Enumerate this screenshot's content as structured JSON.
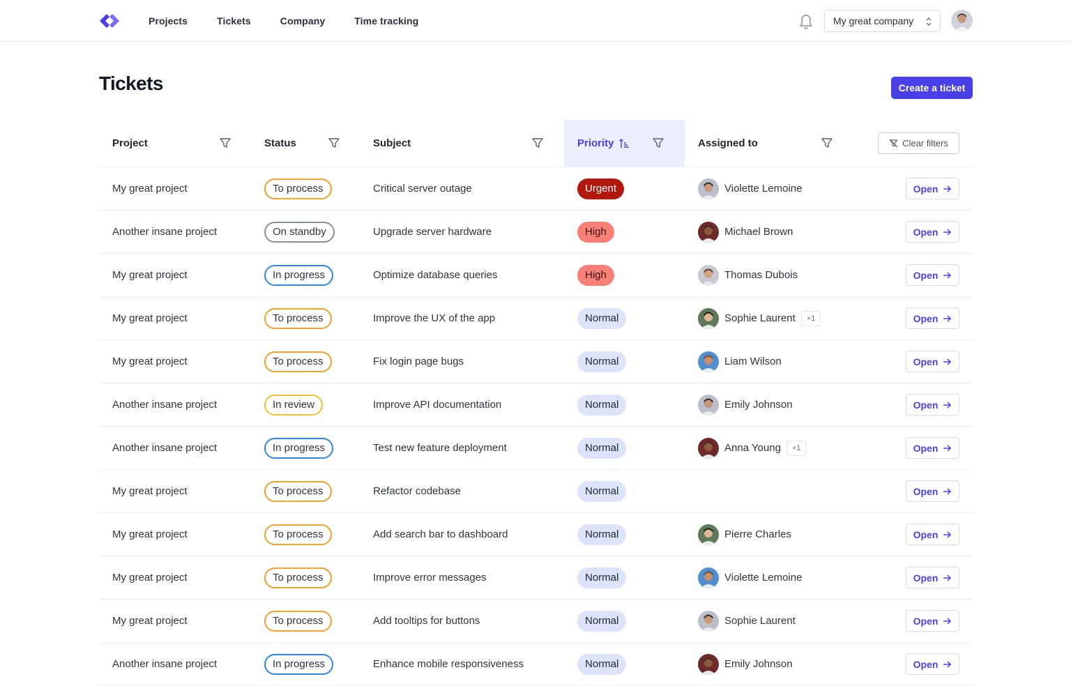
{
  "header": {
    "nav": [
      "Projects",
      "Tickets",
      "Company",
      "Time tracking"
    ],
    "company_select": "My great company",
    "brand_color": "#4a3ee6"
  },
  "page": {
    "title": "Tickets",
    "create_label": "Create a ticket"
  },
  "table": {
    "columns": {
      "project": "Project",
      "status": "Status",
      "subject": "Subject",
      "priority": "Priority",
      "assigned": "Assigned to"
    },
    "sorted_column": "priority",
    "clear_filters_label": "Clear filters",
    "open_label": "Open",
    "rows": [
      {
        "project": "My great project",
        "status": "To process",
        "subject": "Critical server outage",
        "priority": "Urgent",
        "assigned": "Violette Lemoine",
        "extra": ""
      },
      {
        "project": "Another insane project",
        "status": "On standby",
        "subject": "Upgrade server hardware",
        "priority": "High",
        "assigned": "Michael Brown",
        "extra": ""
      },
      {
        "project": "My great project",
        "status": "In progress",
        "subject": "Optimize database queries",
        "priority": "High",
        "assigned": "Thomas Dubois",
        "extra": ""
      },
      {
        "project": "My great project",
        "status": "To process",
        "subject": "Improve the UX of the app",
        "priority": "Normal",
        "assigned": "Sophie Laurent",
        "extra": "+1"
      },
      {
        "project": "My great project",
        "status": "To process",
        "subject": "Fix login page bugs",
        "priority": "Normal",
        "assigned": "Liam Wilson",
        "extra": ""
      },
      {
        "project": "Another insane project",
        "status": "In review",
        "subject": "Improve API documentation",
        "priority": "Normal",
        "assigned": "Emily Johnson",
        "extra": ""
      },
      {
        "project": "Another insane project",
        "status": "In progress",
        "subject": "Test new feature deployment",
        "priority": "Normal",
        "assigned": "Anna Young",
        "extra": "+1"
      },
      {
        "project": "My great project",
        "status": "To process",
        "subject": "Refactor codebase",
        "priority": "Normal",
        "assigned": "",
        "extra": ""
      },
      {
        "project": "My great project",
        "status": "To process",
        "subject": "Add search bar to dashboard",
        "priority": "Normal",
        "assigned": "Pierre Charles",
        "extra": ""
      },
      {
        "project": "My great project",
        "status": "To process",
        "subject": "Improve error messages",
        "priority": "Normal",
        "assigned": "Violette Lemoine",
        "extra": ""
      },
      {
        "project": "My great project",
        "status": "To process",
        "subject": "Add tooltips for buttons",
        "priority": "Normal",
        "assigned": "Sophie Laurent",
        "extra": ""
      },
      {
        "project": "Another insane project",
        "status": "In progress",
        "subject": "Enhance mobile responsiveness",
        "priority": "Normal",
        "assigned": "Emily Johnson",
        "extra": ""
      }
    ]
  },
  "colors": {
    "status": {
      "To process": "#f3a12a",
      "On standby": "#8a8f9b",
      "In progress": "#2a87e3",
      "In review": "#efc12a"
    },
    "priority": {
      "Urgent": "#b3180e",
      "High": "#f88077",
      "Normal": "#dde3fb"
    }
  }
}
